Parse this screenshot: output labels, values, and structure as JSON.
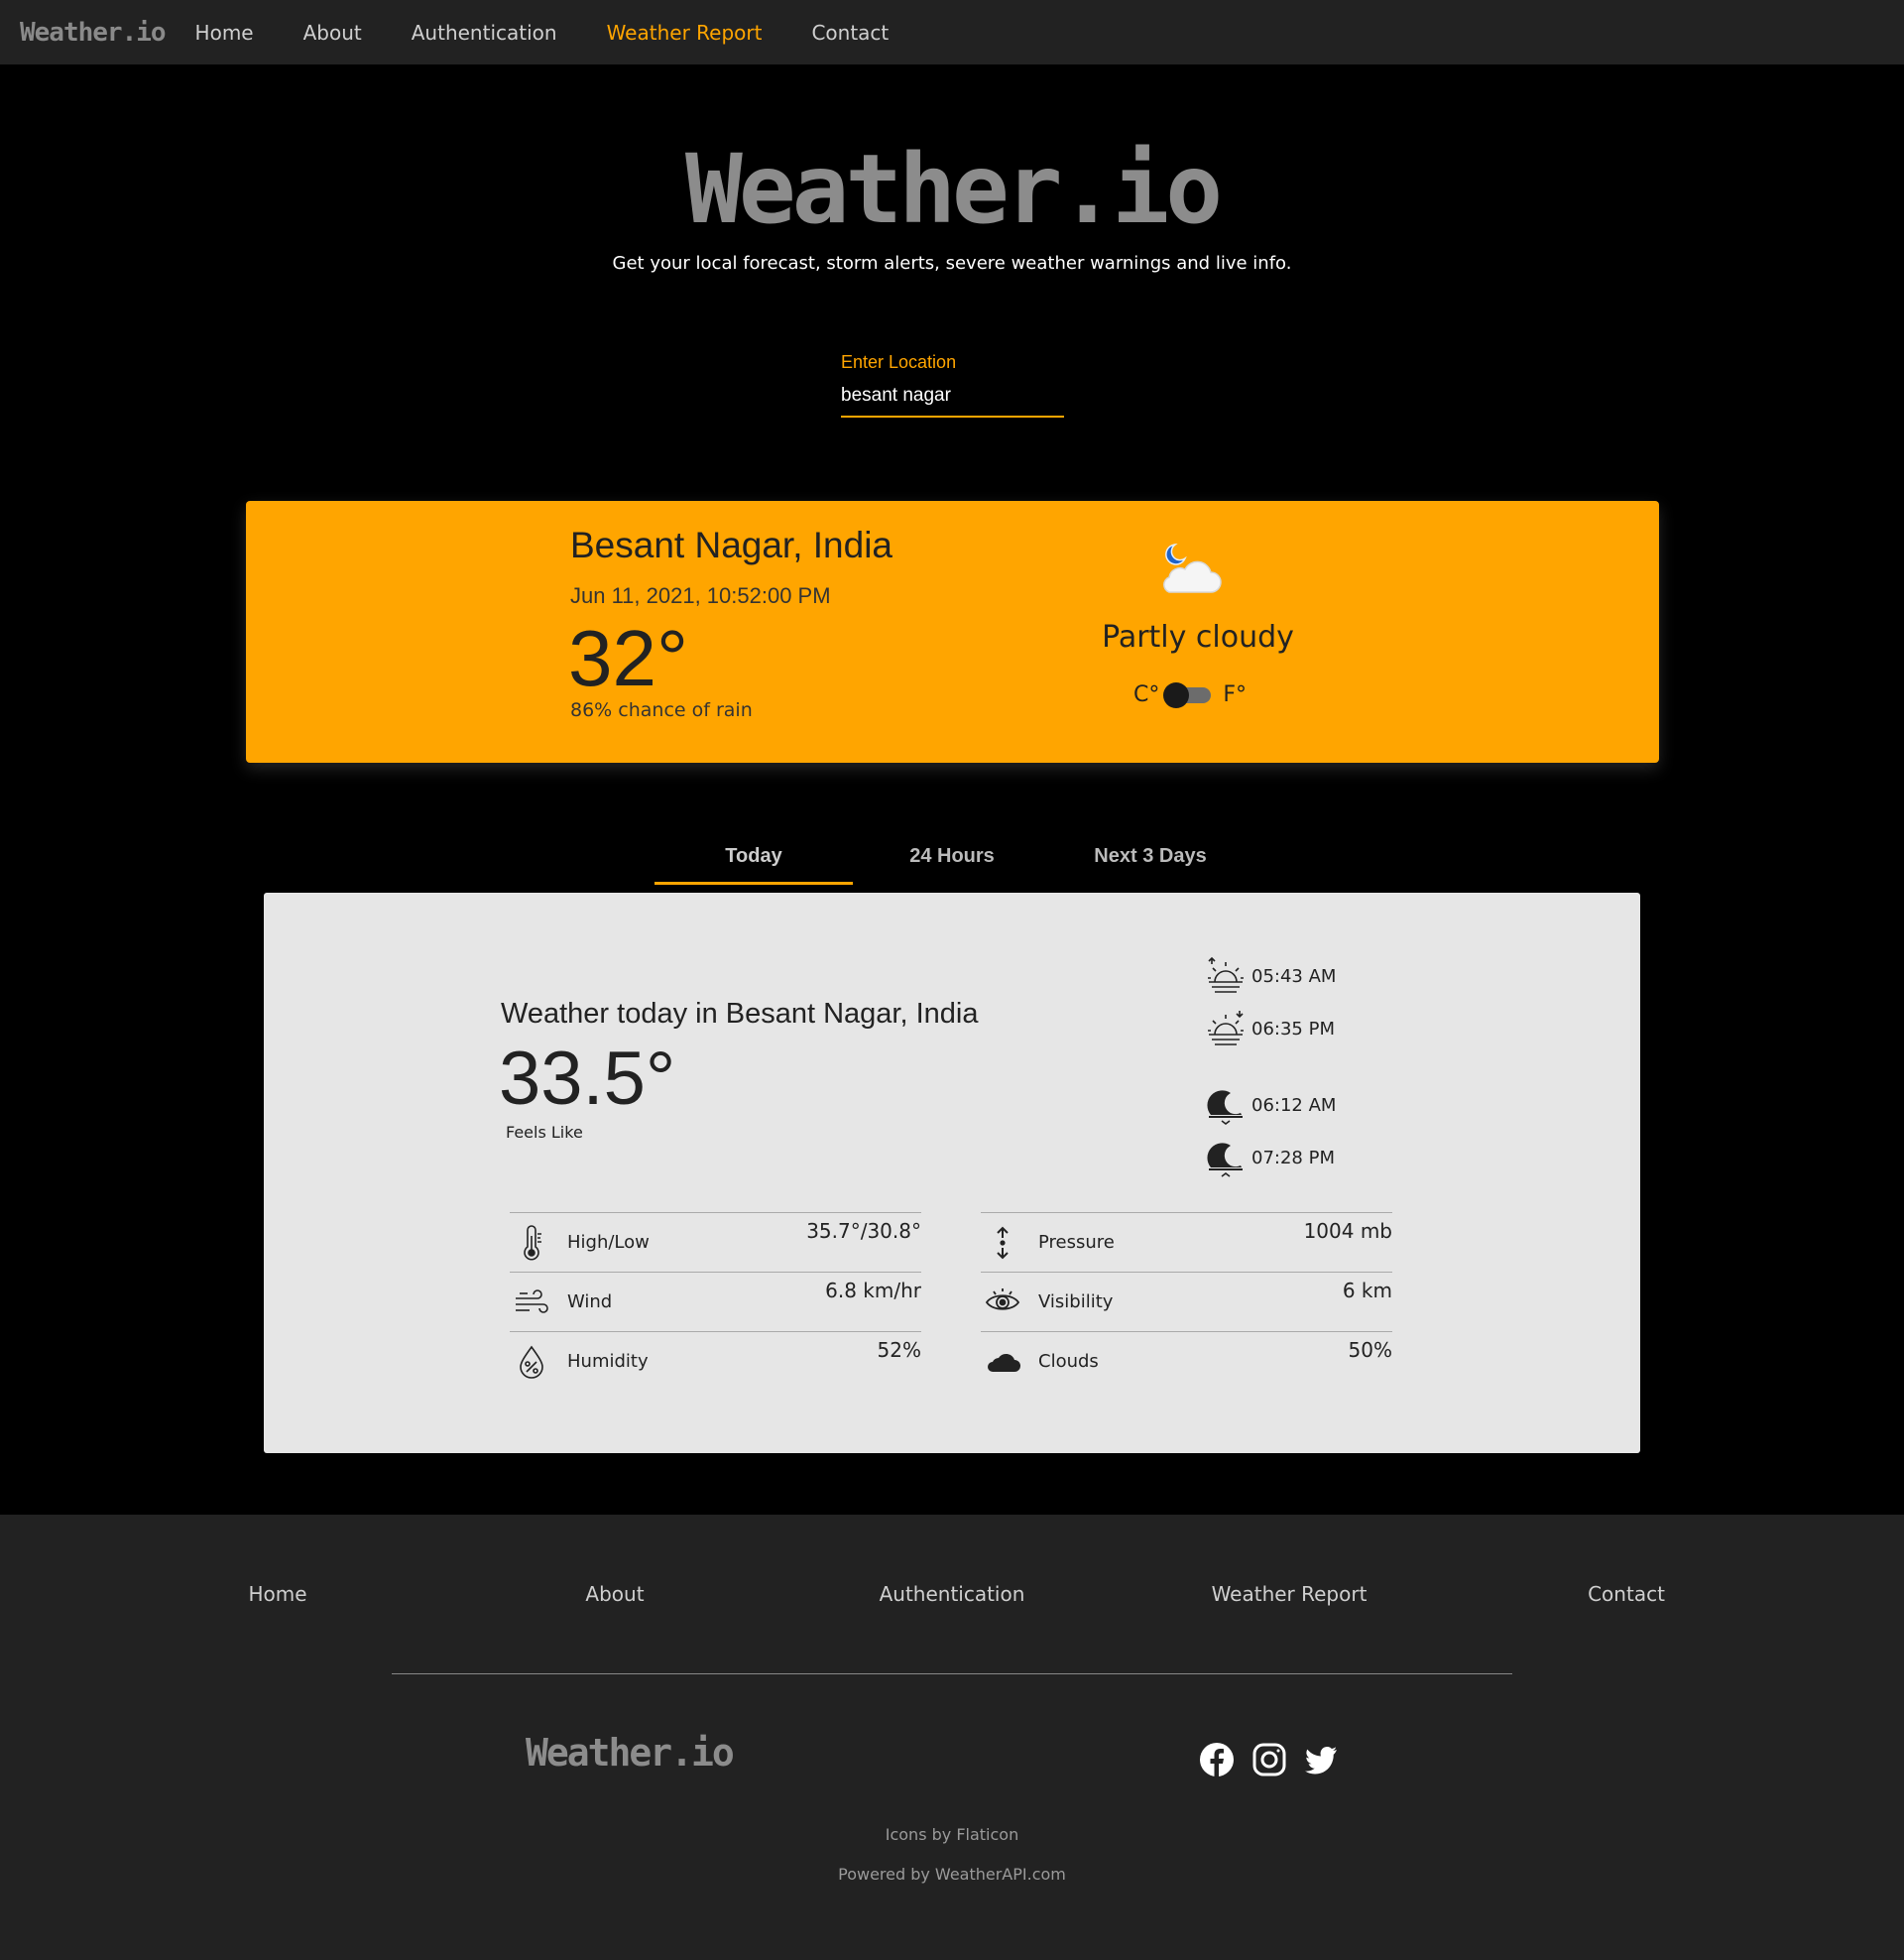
{
  "nav": {
    "logo": "Weather.io",
    "links": [
      "Home",
      "About",
      "Authentication",
      "Weather Report",
      "Contact"
    ],
    "active": "Weather Report"
  },
  "hero": {
    "title": "Weather.io",
    "subtitle": "Get your local forecast, storm alerts, severe weather warnings and live info."
  },
  "location": {
    "label": "Enter Location",
    "value": "besant nagar"
  },
  "current": {
    "city": "Besant Nagar, India",
    "datetime": "Jun 11, 2021, 10:52:00 PM",
    "temp": "32°",
    "rain": "86% chance of rain",
    "condition": "Partly cloudy",
    "icon": "partly-cloudy-night-icon",
    "unit_c": "C°",
    "unit_f": "F°",
    "unit_selected": "C"
  },
  "tabs": [
    "Today",
    "24 Hours",
    "Next 3 Days"
  ],
  "active_tab": "Today",
  "today": {
    "heading": "Weather today in Besant Nagar, India",
    "temp": "33.5°",
    "feels_label": "Feels Like",
    "sunrise": "05:43 AM",
    "sunset": "06:35 PM",
    "moonrise": "06:12 AM",
    "moonset": "07:28 PM",
    "left_stats": [
      {
        "icon": "thermometer-icon",
        "label": "High/Low",
        "value": "35.7°/30.8°"
      },
      {
        "icon": "wind-icon",
        "label": "Wind",
        "value": "6.8 km/hr"
      },
      {
        "icon": "humidity-icon",
        "label": "Humidity",
        "value": "52%"
      }
    ],
    "right_stats": [
      {
        "icon": "pressure-icon",
        "label": "Pressure",
        "value": "1004 mb"
      },
      {
        "icon": "visibility-icon",
        "label": "Visibility",
        "value": "6 km"
      },
      {
        "icon": "cloud-icon",
        "label": "Clouds",
        "value": "50%"
      }
    ]
  },
  "footer": {
    "links": [
      "Home",
      "About",
      "Authentication",
      "Weather Report",
      "Contact"
    ],
    "logo": "Weather.io",
    "social": [
      "facebook-icon",
      "instagram-icon",
      "twitter-icon"
    ],
    "credit_icons": "Icons by Flaticon",
    "credit_api": "Powered by WeatherAPI.com"
  },
  "colors": {
    "accent": "#ffa500",
    "nav_bg": "#222222",
    "page_bg": "#000000",
    "panel_bg": "#e6e6e6"
  }
}
